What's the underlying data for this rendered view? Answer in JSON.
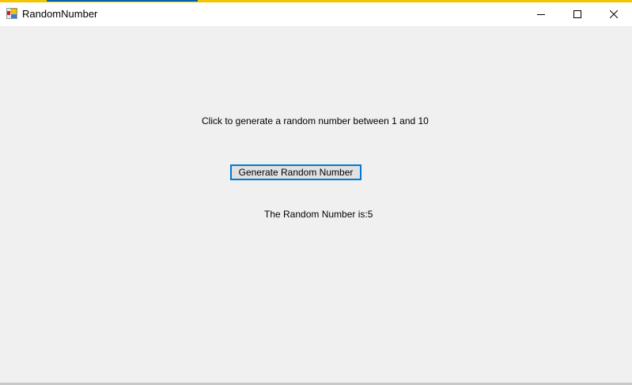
{
  "window": {
    "title": "RandomNumber",
    "app_icon": "winforms-app-icon",
    "controls": [
      "minimize-icon",
      "maximize-icon",
      "close-icon"
    ]
  },
  "form": {
    "instruction": "Click to generate a random number between 1 and 10",
    "button_label": "Generate Random Number",
    "result_text": "The Random Number is:5"
  },
  "colors": {
    "focus_border": "#0078d7",
    "accent_top": "#f2c500",
    "background": "#f0f0f0"
  }
}
